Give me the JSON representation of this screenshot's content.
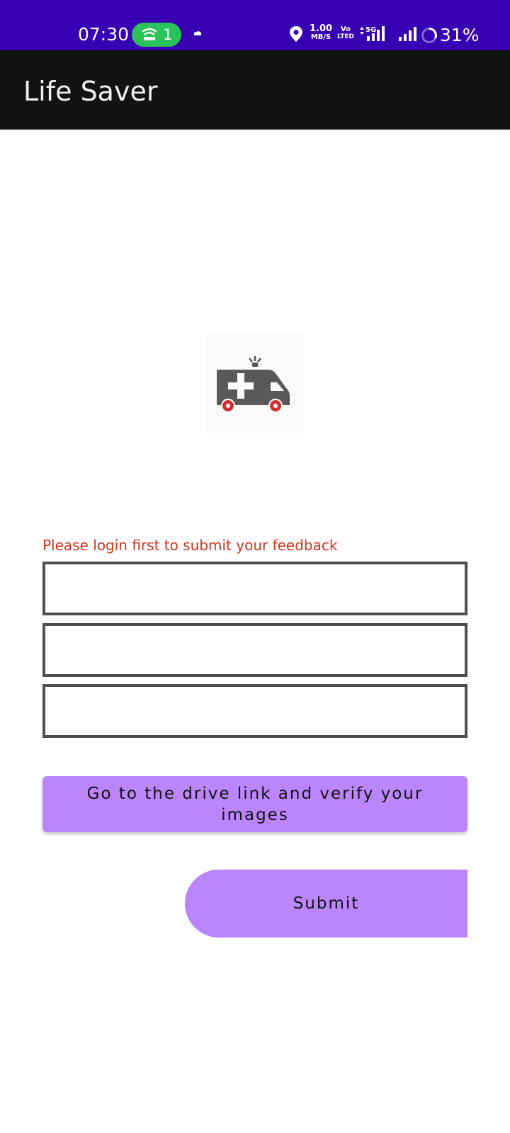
{
  "status_bar": {
    "time": "07:30",
    "hotspot_count": "1",
    "net_speed_value": "1.00",
    "net_speed_unit": "MB/S",
    "volte_top": "Vo",
    "volte_bottom": "LTED",
    "network_type": "5G",
    "battery": "31%",
    "background_color": "#3700b3",
    "icons": [
      "hotspot-icon",
      "cloud-icon",
      "location-icon",
      "signal-5g-icon",
      "signal-icon",
      "battery-ring-icon"
    ]
  },
  "app_bar": {
    "title": "Life Saver",
    "background_color": "#131313"
  },
  "logo": {
    "icon": "ambulance-icon"
  },
  "form": {
    "login_message": "Please login first to submit your feedback",
    "fields": [
      {
        "value": "",
        "placeholder": ""
      },
      {
        "value": "",
        "placeholder": ""
      },
      {
        "value": "",
        "placeholder": ""
      }
    ],
    "drive_button_label": "Go to the drive link and verify your images",
    "submit_label": "Submit",
    "accent_color": "#bb86fc",
    "error_color": "#c8381f"
  }
}
